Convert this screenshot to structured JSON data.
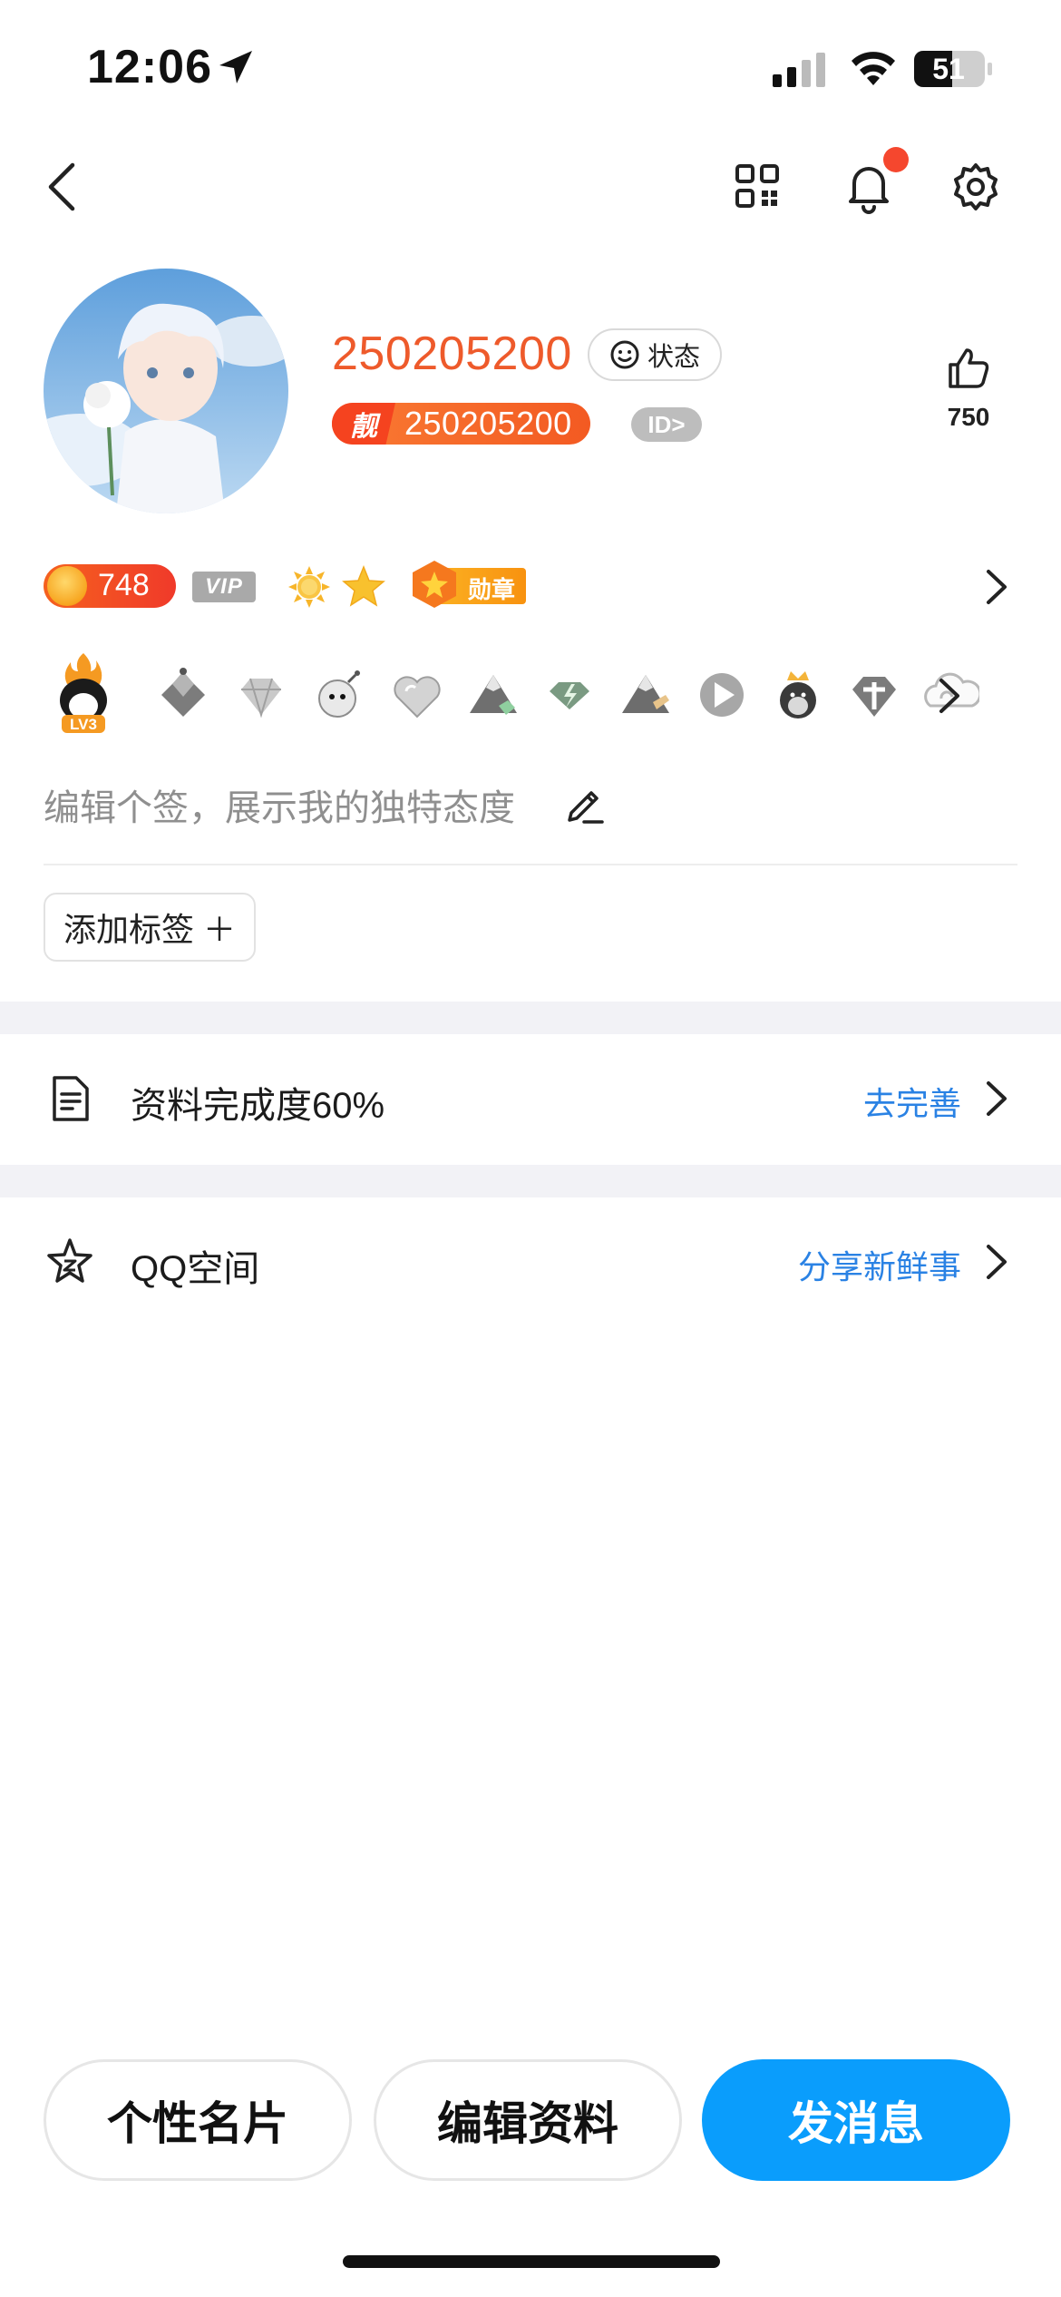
{
  "status_bar": {
    "time": "12:06",
    "battery": "51"
  },
  "profile": {
    "nickname": "250205200",
    "status_label": "状态",
    "badge_prefix": "靓",
    "id_number": "250205200",
    "id_tag": "ID>",
    "likes": "750"
  },
  "badges": {
    "coin_count": "748",
    "vip_label": "VIP",
    "medal_label": "勋章",
    "level_label": "LV3"
  },
  "signature": {
    "placeholder": "编辑个签，展示我的独特态度"
  },
  "tag_button": {
    "label": "添加标签 ＋"
  },
  "list": {
    "profile_completion": {
      "label": "资料完成度60%",
      "action": "去完善"
    },
    "qzone": {
      "label": "QQ空间",
      "action": "分享新鲜事"
    }
  },
  "bottom_bar": {
    "card_label": "个性名片",
    "edit_label": "编辑资料",
    "message_label": "发消息"
  },
  "colors": {
    "nickname": "#ee5a2b",
    "accent_blue": "#0a9dfc",
    "link_blue": "#2a82e4",
    "notification_dot": "#f5472e"
  }
}
